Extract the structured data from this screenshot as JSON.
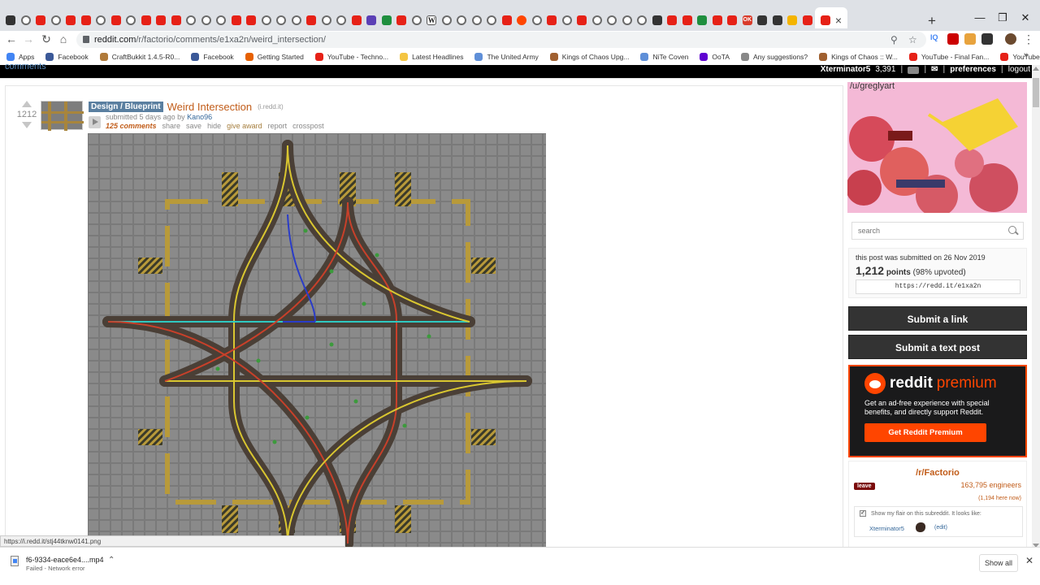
{
  "browser": {
    "url_host": "reddit.com",
    "url_path": "/r/factorio/comments/e1xa2n/weird_intersection/",
    "tab_favicons": [
      "amazon",
      "gl",
      "yt",
      "gl",
      "yt",
      "yt",
      "gl",
      "yt",
      "gl",
      "yt",
      "yt",
      "yt",
      "gl",
      "gl",
      "gl",
      "yt",
      "yt",
      "gl",
      "gl",
      "gl",
      "yt",
      "gl",
      "gl",
      "yt",
      "pu",
      "gr",
      "yt",
      "gl",
      "wk",
      "gl",
      "gl",
      "gl",
      "gl",
      "yt",
      "rd",
      "gl",
      "yt",
      "gl",
      "yt",
      "gl",
      "gl",
      "gl",
      "gl",
      "dk",
      "yt",
      "yt",
      "gr",
      "yt",
      "yt",
      "ok",
      "dk",
      "dk",
      "yl",
      "yt"
    ],
    "colors": {
      "tab_strip": "#dee1e6",
      "youtube_red": "#e62117",
      "reddit_orange": "#ff4500"
    }
  },
  "bookmarks": {
    "items": [
      {
        "label": "Apps",
        "icon": "apps-grid-icon"
      },
      {
        "label": "Facebook",
        "icon": "facebook-icon"
      },
      {
        "label": "CraftBukkit 1.4.5-R0...",
        "icon": "bukkit-icon"
      },
      {
        "label": "Facebook",
        "icon": "facebook-icon"
      },
      {
        "label": "Getting Started",
        "icon": "firefox-icon"
      },
      {
        "label": "YouTube - Techno...",
        "icon": "youtube-icon"
      },
      {
        "label": "Latest Headlines",
        "icon": "folder-icon"
      },
      {
        "label": "The United Army",
        "icon": "globe-icon"
      },
      {
        "label": "Kings of Chaos Upg...",
        "icon": "koc-icon"
      },
      {
        "label": "NiTe Coven",
        "icon": "globe-icon"
      },
      {
        "label": "OoTA",
        "icon": "yahoo-icon"
      },
      {
        "label": "Any suggestions?",
        "icon": "link-icon"
      },
      {
        "label": "Kings of Chaos :: W...",
        "icon": "koc-icon"
      },
      {
        "label": "YouTube - Final Fan...",
        "icon": "youtube-icon"
      },
      {
        "label": "YouTube - BassHun...",
        "icon": "youtube-icon"
      }
    ]
  },
  "reddit_header": {
    "left": "comments",
    "username": "Xterminator5",
    "karma": "3,391",
    "preferences": "preferences",
    "logout": "logout"
  },
  "post": {
    "score": "1212",
    "flair": "Design / Blueprint",
    "title": "Weird Intersection",
    "domain": "(i.redd.it)",
    "submitted_prefix": "submitted",
    "time_ago": "5 days ago",
    "by": "by",
    "author": "Kano96",
    "buttons": {
      "comments": "125 comments",
      "share": "share",
      "save": "save",
      "hide": "hide",
      "award": "give award",
      "report": "report",
      "crosspost": "crosspost"
    }
  },
  "sidebar": {
    "banner_user": "/u/greglyart",
    "search_placeholder": "search",
    "submitted_text": "this post was submitted on 26 Nov 2019",
    "points_num": "1,212",
    "points_word": "points",
    "upvoted": "(98% upvoted)",
    "shortlink": "https://redd.it/e1xa2n",
    "submit_link": "Submit a link",
    "submit_text": "Submit a text post",
    "premium": {
      "brand1": "reddit",
      "brand2": "premium",
      "text": "Get an ad-free experience with special benefits, and directly support Reddit.",
      "button": "Get Reddit Premium"
    },
    "subreddit": {
      "name": "/r/Factorio",
      "leave": "leave",
      "subscribers": "163,795 engineers",
      "here_now": "(1,194 here now)",
      "flair_label": "Show my flair on this subreddit. It looks like:",
      "flair_user": "Xterminator5",
      "edit": "(edit)"
    }
  },
  "status_url": "https://i.redd.it/stj44tknw0141.png",
  "download": {
    "filename": "f6-9334-eace6e4....mp4",
    "status": "Failed - Network error",
    "show_all": "Show all"
  }
}
